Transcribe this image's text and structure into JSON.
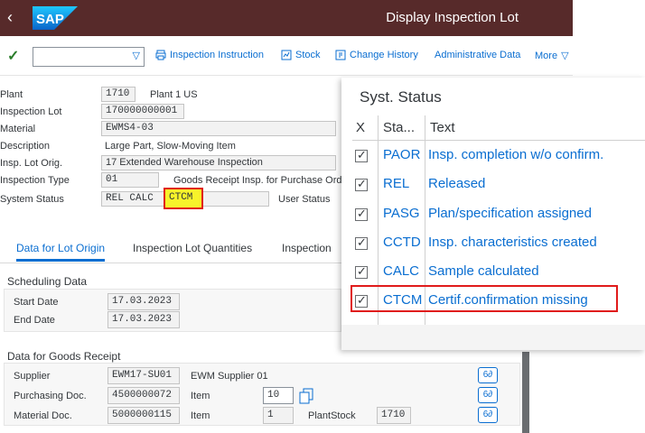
{
  "shell": {
    "title": "Display Inspection Lot",
    "brand": "SAP",
    "back": "‹"
  },
  "toolbar": {
    "check": "✓",
    "combo_value": "",
    "combo_arrow": "▽",
    "buttons": {
      "inspection_instruction": "Inspection Instruction",
      "stock": "Stock",
      "change_history": "Change History",
      "administrative_data": "Administrative Data",
      "more": "More"
    }
  },
  "header": {
    "plant": {
      "label": "Plant",
      "value": "1710",
      "text": "Plant 1 US"
    },
    "inspection_lot": {
      "label": "Inspection Lot",
      "value": "170000000001"
    },
    "material": {
      "label": "Material",
      "value": "EWMS4-03"
    },
    "description": {
      "label": "Description",
      "text": "Large Part, Slow-Moving Item"
    },
    "insp_lot_orig": {
      "label": "Insp. Lot Orig.",
      "value": "17 Extended Warehouse Inspection"
    },
    "inspection_type": {
      "label": "Inspection Type",
      "value": "01",
      "text": "Goods Receipt Insp. for Purchase Ord"
    },
    "system_status": {
      "label": "System Status",
      "value": "REL  CALC",
      "highlight": "CTCM",
      "user_status_label": "User Status"
    }
  },
  "tabs": [
    {
      "label": "Data for Lot Origin",
      "active": true
    },
    {
      "label": "Inspection Lot Quantities",
      "active": false
    },
    {
      "label": "Inspection",
      "active": false
    }
  ],
  "scheduling": {
    "title": "Scheduling Data",
    "start_date": {
      "label": "Start Date",
      "value": "17.03.2023"
    },
    "end_date": {
      "label": "End Date",
      "value": "17.03.2023"
    }
  },
  "goods_receipt": {
    "title": "Data for Goods Receipt",
    "supplier": {
      "label": "Supplier",
      "value": "EWM17-SU01",
      "text": "EWM Supplier 01"
    },
    "purchasing_doc": {
      "label": "Purchasing Doc.",
      "value": "4500000072",
      "item_label": "Item",
      "item_value": "10"
    },
    "material_doc": {
      "label": "Material Doc.",
      "value": "5000000115",
      "item_label": "Item",
      "item_value": "1",
      "plant_stock_label": "PlantStock",
      "plant_stock_value": "1710"
    },
    "glasses_icon": "6∂"
  },
  "status_popup": {
    "title": "Syst. Status",
    "columns": {
      "x": "X",
      "status": "Sta...",
      "text": "Text"
    },
    "rows": [
      {
        "code": "PAOR",
        "text": "Insp. completion w/o confirm."
      },
      {
        "code": "REL",
        "text": "Released"
      },
      {
        "code": "PASG",
        "text": "Plan/specification assigned"
      },
      {
        "code": "CCTD",
        "text": "Insp. characteristics created"
      },
      {
        "code": "CALC",
        "text": "Sample calculated"
      },
      {
        "code": "CTCM",
        "text": "Certif.confirmation missing"
      }
    ]
  },
  "colors": {
    "shell": "#572a2a",
    "link": "#0a6ed1",
    "highlight_fill": "#f7f32a",
    "highlight_border": "#e01b1b"
  }
}
